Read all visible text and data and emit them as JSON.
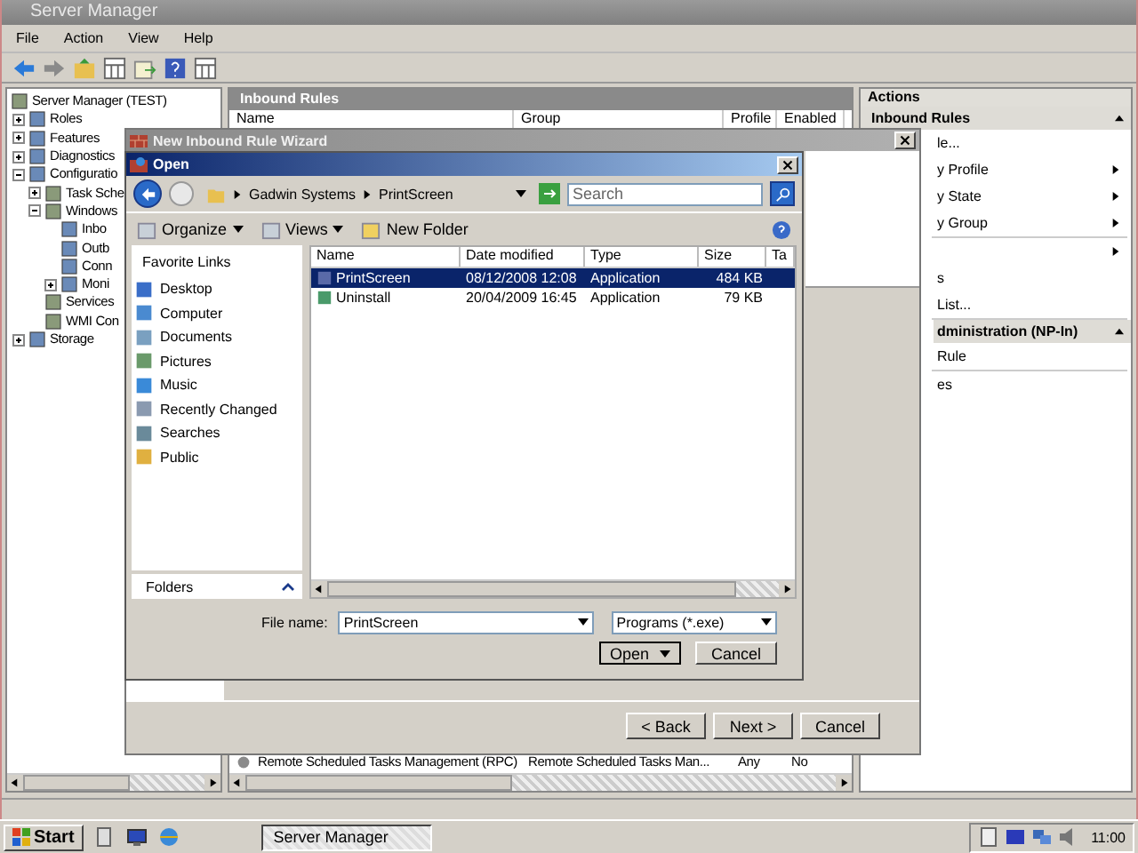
{
  "server_manager": {
    "title": "Server Manager",
    "menu": [
      "File",
      "Action",
      "View",
      "Help"
    ],
    "tree": [
      {
        "label": "Server Manager (TEST)",
        "children": [
          {
            "label": "Roles",
            "expanded": false
          },
          {
            "label": "Features",
            "expanded": false
          },
          {
            "label": "Diagnostics",
            "expanded": false
          },
          {
            "label": "Configuratio",
            "expanded": true,
            "children": [
              {
                "label": "Task Sche",
                "expanded": false
              },
              {
                "label": "Windows",
                "expanded": true,
                "children": [
                  {
                    "label": "Inbo"
                  },
                  {
                    "label": "Outb"
                  },
                  {
                    "label": "Conn"
                  },
                  {
                    "label": "Moni",
                    "expanded": false
                  }
                ]
              },
              {
                "label": "Services"
              },
              {
                "label": "WMI Con"
              }
            ]
          },
          {
            "label": "Storage",
            "expanded": false
          }
        ]
      }
    ],
    "center": {
      "title": "Inbound Rules",
      "columns": [
        "Name",
        "Group",
        "Profile",
        "Enabled"
      ],
      "rows": [
        {
          "name": "Remote Scheduled Tasks Management (RPC)",
          "group": "Remote Scheduled Tasks Man...",
          "profile": "Any",
          "enabled": "No"
        }
      ]
    },
    "actions": {
      "title": "Actions",
      "items": [
        {
          "kind": "header",
          "label": "Inbound Rules"
        },
        {
          "kind": "action",
          "label": "le...",
          "submenu": false
        },
        {
          "kind": "action",
          "label": "y Profile",
          "submenu": true
        },
        {
          "kind": "action",
          "label": "y State",
          "submenu": true
        },
        {
          "kind": "action",
          "label": "y Group",
          "submenu": true
        },
        {
          "kind": "separator"
        },
        {
          "kind": "action",
          "submenu": true
        },
        {
          "kind": "action",
          "label": "s",
          "submenu": false
        },
        {
          "kind": "action",
          "label": "List...",
          "submenu": false
        },
        {
          "kind": "separator"
        },
        {
          "kind": "header",
          "label": "dministration (NP-In)"
        },
        {
          "kind": "action",
          "label": "Rule",
          "submenu": false
        },
        {
          "kind": "separator"
        },
        {
          "kind": "action",
          "label": "es",
          "submenu": false
        }
      ]
    }
  },
  "wizard": {
    "title": "New Inbound Rule Wizard",
    "buttons": [
      "< Back",
      "Next >",
      "Cancel"
    ]
  },
  "open_dialog": {
    "title": "Open",
    "path": [
      "Gadwin Systems",
      "PrintScreen"
    ],
    "search": {
      "placeholder": "Search"
    },
    "toolbar": [
      "Organize",
      "Views",
      "New Folder"
    ],
    "favorite_links_title": "Favorite Links",
    "favorites": [
      "Desktop",
      "Computer",
      "Documents",
      "Pictures",
      "Music",
      "Recently Changed",
      "Searches",
      "Public"
    ],
    "folders_label": "Folders",
    "columns": [
      "Name",
      "Date modified",
      "Type",
      "Size",
      "Ta"
    ],
    "files": [
      {
        "name": "PrintScreen",
        "date": "08/12/2008 12:08",
        "type": "Application",
        "size": "484 KB",
        "selected": true
      },
      {
        "name": "Uninstall",
        "date": "20/04/2009 16:45",
        "type": "Application",
        "size": "79 KB",
        "selected": false
      }
    ],
    "file_name_label": "File name:",
    "file_name": "PrintScreen",
    "filter": "Programs (*.exe)",
    "buttons": [
      "Open",
      "Cancel"
    ]
  },
  "taskbar": {
    "start": "Start",
    "tasks": [
      "Server Manager"
    ],
    "clock": "11:00"
  }
}
